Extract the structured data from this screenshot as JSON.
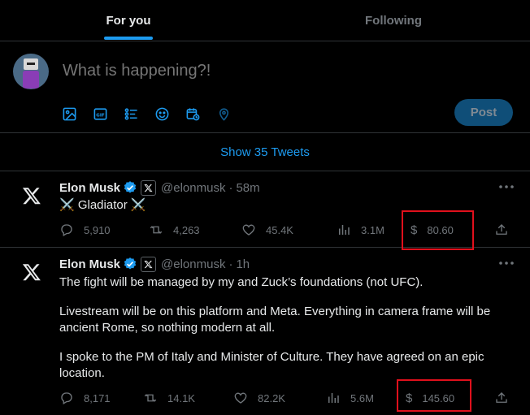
{
  "tabs": [
    {
      "label": "For you",
      "active": true
    },
    {
      "label": "Following",
      "active": false
    }
  ],
  "composer": {
    "placeholder": "What is happening?!",
    "tools": [
      "image-icon",
      "gif-icon",
      "poll-icon",
      "emoji-icon",
      "schedule-icon",
      "location-icon"
    ],
    "post_label": "Post"
  },
  "show_tweets_label": "Show 35 Tweets",
  "tweets": [
    {
      "name": "Elon Musk",
      "handle": "@elonmusk",
      "time": "58m",
      "text": "⚔️ Gladiator ⚔️",
      "replies": "5,910",
      "retweets": "4,263",
      "likes": "45.4K",
      "views": "3.1M",
      "dollar_symbol": "$",
      "dollar_amount": "80.60"
    },
    {
      "name": "Elon Musk",
      "handle": "@elonmusk",
      "time": "1h",
      "paragraphs": [
        "The fight will be managed by my and Zuck’s foundations (not UFC).",
        "Livestream will be on this platform and Meta. Everything in camera frame will be ancient Rome, so nothing modern at all.",
        "I spoke to the PM of Italy and Minister of Culture. They have agreed on an epic location."
      ],
      "replies": "8,171",
      "retweets": "14.1K",
      "likes": "82.2K",
      "views": "5.6M",
      "dollar_symbol": "$",
      "dollar_amount": "145.60"
    }
  ],
  "colors": {
    "accent": "#1d9bf0",
    "highlight_box": "#e0101c",
    "muted": "#71767b",
    "background": "#000000"
  }
}
